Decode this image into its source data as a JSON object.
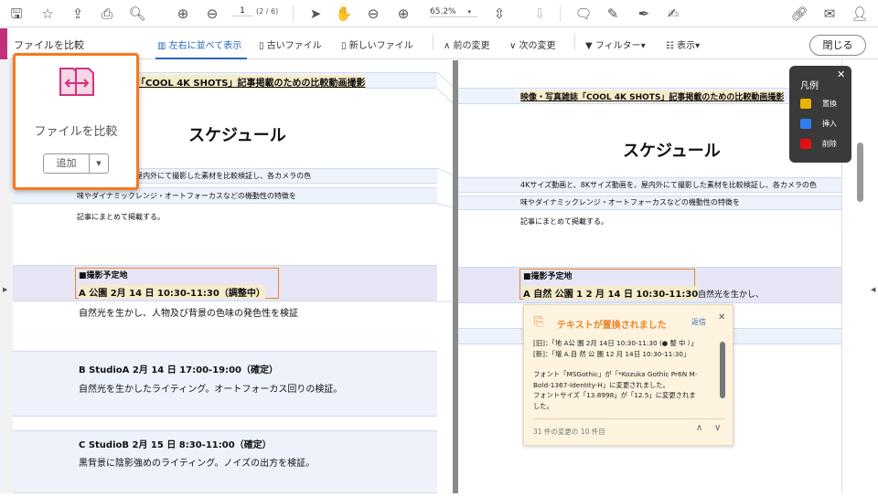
{
  "toolbar": {
    "page_current": "1",
    "page_total": "(2 / 6)",
    "zoom": "65.2%"
  },
  "comparebar": {
    "title": "ファイルを比較",
    "side_by_side": "左右に並べて表示",
    "old_file": "古いファイル",
    "new_file": "新しいファイル",
    "prev_change": "前の変更",
    "next_change": "次の変更",
    "filter": "フィルター",
    "view": "表示",
    "close": "閉じる"
  },
  "compare_panel": {
    "title": "ファイルを比較",
    "add": "追加"
  },
  "legend": {
    "title": "凡例",
    "items": [
      {
        "label": "置換",
        "color": "#e8b400"
      },
      {
        "label": "挿入",
        "color": "#2d7ff0"
      },
      {
        "label": "削除",
        "color": "#e01010"
      }
    ]
  },
  "left_doc": {
    "heading": "「COOL 4K SHOTS」記事掲載のための比較動画撮影",
    "title": "スケジュール",
    "p1": "4Kサイズ動画を、屋内外にて撮影した素材を比較検証し、各カメラの色",
    "p2": "味やダイナミックレンジ・オートフォーカスなどの機動性の特徴を",
    "p3": "記事にまとめて掲載する。",
    "loc_header": "■撮影予定地",
    "loc_a": "A 公園 2月 14 日 10:30-11:30（調整中）",
    "loc_a_desc": "自然光を生かし、人物及び背景の色味の発色性を検証",
    "loc_b": "B StudioA 2月 14 日 17:00-19:00（確定）",
    "loc_b_desc": "自然光を生かしたライティング。オートフォーカス回りの検証。",
    "loc_c": "C StudioB 2月 15 日 8:30-11:00（確定）",
    "loc_c_desc": "黒背景に陰影強めのライティング。ノイズの出方を検証。"
  },
  "right_doc": {
    "heading": "映像・写真雑誌「COOL 4K SHOTS」記事掲載のための比較動画撮影",
    "title": "スケジュール",
    "p1": "4Kサイズ動画と、8Kサイズ動画を、屋内外にて撮影した素材を比較検証し、各カメラの色",
    "p2": "味やダイナミックレンジ・オートフォーカスなどの機動性の特徴を",
    "p3": "記事にまとめて掲載する。",
    "loc_header": "■撮影予定地",
    "loc_a": "A 自然 公園 1 2 月 14 日 10:30-11:30",
    "loc_a_desc": "自然光を生かし、"
  },
  "popup": {
    "title": "テキストが置換されました",
    "reply": "返信",
    "old": "[旧]：「地 A公 園 2月 14日 10:30-11:30 (● 整 中 ）」",
    "new": "[新]：「増 A.自 然 公 園 12 月 14日 10:30-11:30」",
    "font_line1": "フォント「MSGothic」が「*Kozuka Gothic Pr6N M-",
    "font_line2": "Bold-1367-Identity-H」に変更されました。",
    "size_line1": "フォントサイズ「13.8998」が「12.5」に変更されま",
    "size_line2": "した。",
    "counter": "31 件の変更の 10 件目"
  }
}
